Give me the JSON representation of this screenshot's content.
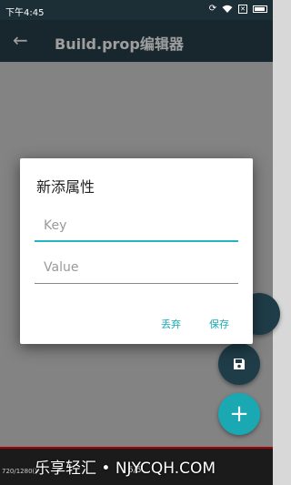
{
  "status_bar": {
    "time": "下午4:45",
    "icons": [
      "sync-icon",
      "wifi-icon",
      "sim-icon",
      "battery-icon"
    ]
  },
  "app_bar": {
    "title": "Build.prop编辑器",
    "back_icon": "arrow-back-icon"
  },
  "fabs": {
    "save_icon": "save-icon",
    "add_icon": "add-icon",
    "add_glyph": "+"
  },
  "dialog": {
    "title": "新添属性",
    "key_placeholder": "Key",
    "value_placeholder": "Value",
    "discard_label": "丢弃",
    "save_label": "保存"
  },
  "bottom": {
    "resolution": "720/1280()",
    "page": "5/5",
    "watermark": "乐享轻汇 • NJYCQH.COM"
  },
  "colors": {
    "accent": "#1aa9b3",
    "app_bar": "#28404a",
    "status_bar": "#1d2f36"
  }
}
